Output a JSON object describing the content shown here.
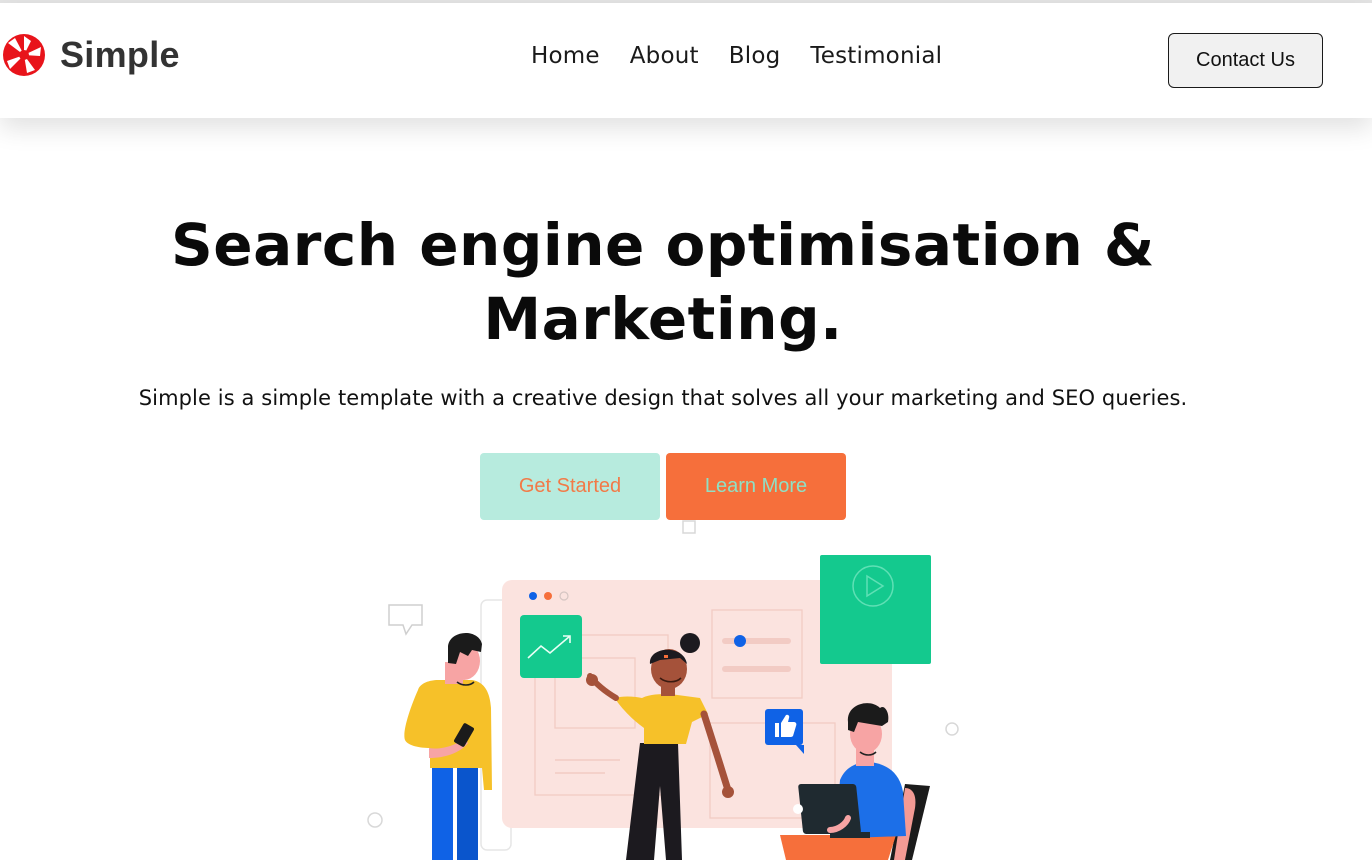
{
  "brand": {
    "name": "Simple",
    "logo_icon": "aperture-logo-icon",
    "logo_color": "#e8141b"
  },
  "nav": {
    "items": [
      {
        "label": "Home"
      },
      {
        "label": "About"
      },
      {
        "label": "Blog"
      },
      {
        "label": "Testimonial"
      }
    ],
    "contact_label": "Contact Us"
  },
  "hero": {
    "title": "Search engine optimisation & Marketing.",
    "subtitle": "Simple is a simple template with a creative design that solves all your marketing and SEO queries.",
    "primary_button": "Get Started",
    "secondary_button": "Learn More"
  },
  "colors": {
    "mint": "#b7ebde",
    "orange": "#f66f3b",
    "green": "#14c98e",
    "blue": "#0f62e6",
    "yellow": "#f6c129",
    "pink_panel": "#fbe3df"
  },
  "illustration": {
    "icons": [
      "chat-bubble-icon",
      "trend-chart-icon",
      "play-icon",
      "thumbs-up-icon",
      "laptop-icon",
      "phone-icon"
    ]
  }
}
